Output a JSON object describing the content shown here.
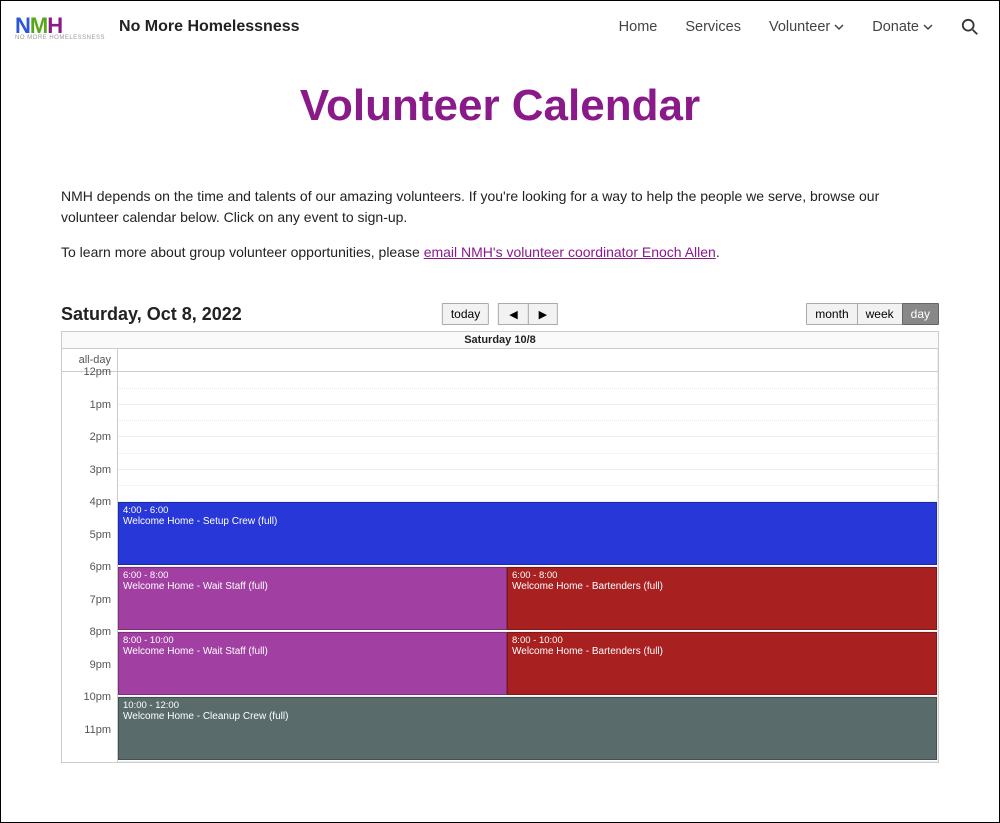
{
  "header": {
    "site_name": "No More Homelessness",
    "logo_sub": "NO MORE HOMELESSNESS",
    "nav": [
      "Home",
      "Services",
      "Volunteer",
      "Donate"
    ]
  },
  "page": {
    "title": "Volunteer Calendar",
    "intro1": "NMH depends on the time and talents of our amazing volunteers. If you're looking for a way to help the people we serve, browse our volunteer calendar below. Click on any event to sign-up.",
    "intro2_pre": "To learn more about group volunteer opportunities, please ",
    "intro2_link": "email NMH's volunteer coordinator Enoch Allen",
    "intro2_post": "."
  },
  "calendar": {
    "date_label": "Saturday, Oct 8, 2022",
    "today": "today",
    "views": {
      "month": "month",
      "week": "week",
      "day": "day"
    },
    "day_header": "Saturday 10/8",
    "allday_label": "all-day",
    "hours": [
      "12pm",
      "1pm",
      "2pm",
      "3pm",
      "4pm",
      "5pm",
      "6pm",
      "7pm",
      "8pm",
      "9pm",
      "10pm",
      "11pm"
    ],
    "events": [
      {
        "time": "4:00 - 6:00",
        "name": "Welcome Home - Setup Crew (full)"
      },
      {
        "time": "6:00 - 8:00",
        "name": "Welcome Home - Wait Staff (full)"
      },
      {
        "time": "6:00 - 8:00",
        "name": "Welcome Home - Bartenders (full)"
      },
      {
        "time": "8:00 - 10:00",
        "name": "Welcome Home - Wait Staff (full)"
      },
      {
        "time": "8:00 - 10:00",
        "name": "Welcome Home - Bartenders (full)"
      },
      {
        "time": "10:00 - 12:00",
        "name": "Welcome Home - Cleanup Crew (full)"
      }
    ]
  }
}
